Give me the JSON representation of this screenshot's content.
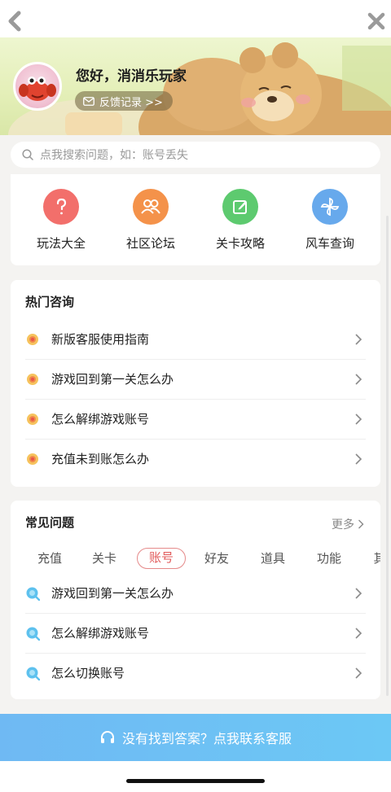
{
  "header": {
    "greeting": "您好，消消乐玩家",
    "feedback_label": "反馈记录 >>"
  },
  "search": {
    "placeholder": "点我搜索问题，如：账号丢失"
  },
  "quick_links": [
    {
      "label": "玩法大全",
      "icon": "question-icon",
      "color": "#f26f6b"
    },
    {
      "label": "社区论坛",
      "icon": "people-icon",
      "color": "#f4924a"
    },
    {
      "label": "关卡攻略",
      "icon": "edit-icon",
      "color": "#5dca6f"
    },
    {
      "label": "风车查询",
      "icon": "pinwheel-icon",
      "color": "#67a9ec"
    }
  ],
  "hot": {
    "title": "热门咨询",
    "items": [
      "新版客服使用指南",
      "游戏回到第一关怎么办",
      "怎么解绑游戏账号",
      "充值未到账怎么办"
    ]
  },
  "faq": {
    "title": "常见问题",
    "more": "更多",
    "tabs": [
      "充值",
      "关卡",
      "账号",
      "好友",
      "道具",
      "功能",
      "其"
    ],
    "active_tab": "账号",
    "items": [
      "游戏回到第一关怎么办",
      "怎么解绑游戏账号",
      "怎么切换账号"
    ]
  },
  "bottom": {
    "label": "没有找到答案？点我联系客服"
  },
  "colors": {
    "accent_blue": "#6fb9f3",
    "active_tab": "#e15a5a"
  }
}
